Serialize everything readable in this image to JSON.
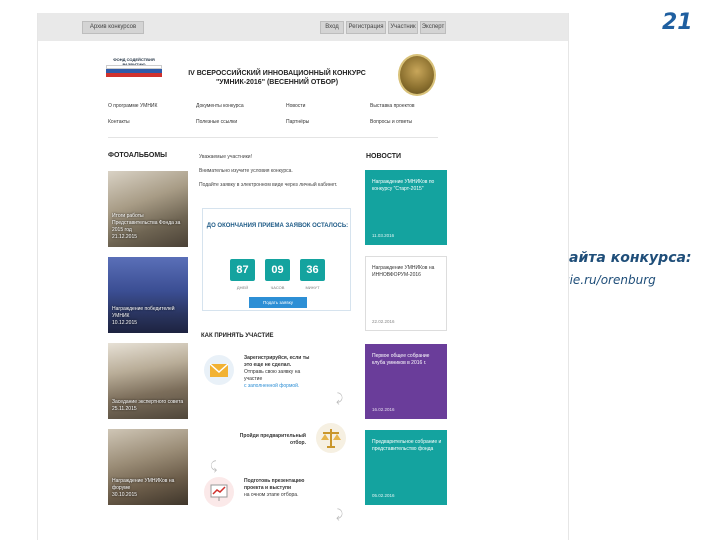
{
  "slide": {
    "page_number": "21",
    "caption_title": "Скриншот сайта конкурса:",
    "caption_url": "http://umnik.fasie.ru/orenburg"
  },
  "site": {
    "topbar": {
      "left_button": "Архив конкурсов",
      "buttons": [
        "Вход",
        "Регистрация",
        "Участник",
        "Эксперт"
      ]
    },
    "header": {
      "title_line1": "IV ВСЕРОССИЙСКИЙ ИННОВАЦИОННЫЙ КОНКУРС",
      "title_line2": "\"УМНИК-2016\" (ВЕСЕННИЙ ОТБОР)",
      "logo_text": "ФОНД СОДЕЙСТВИЯ РАЗВИТИЮ"
    },
    "nav": [
      "О программе УМНИК",
      "Документы конкурса",
      "Новости",
      "Выставка проектов",
      "Контакты",
      "Полезные ссылки",
      "Партнёры",
      "Вопросы и ответы"
    ],
    "photo_albums": {
      "title": "ФОТОАЛЬБОМЫ",
      "items": [
        {
          "caption": "Итоги работы Представительства Фонда за 2015 год",
          "date": "21.12.2015"
        },
        {
          "caption": "Награждение победителей УМНИК",
          "date": "10.12.2015"
        },
        {
          "caption": "Заседание экспертного совета",
          "date": "25.11.2015"
        },
        {
          "caption": "Награждение УМНИКов на форуме",
          "date": "30.10.2015"
        }
      ]
    },
    "middle": {
      "intro1": "Уважаемые участники!",
      "intro2": "Внимательно изучите условия конкурса.",
      "intro3": "Подайте заявку в электронном виде через личный кабинет.",
      "countdown_title": "ДО ОКОНЧАНИЯ ПРИЕМА ЗАЯВОК ОСТАЛОСЬ:",
      "days": "87",
      "hours": "09",
      "minutes": "36",
      "days_label": "ДНЕЙ",
      "hours_label": "ЧАСОВ",
      "minutes_label": "МИНУТ",
      "submit_button": "Подать заявку",
      "how_title": "КАК ПРИНЯТЬ УЧАСТИЕ",
      "step1_line1": "Зарегистрируйся, если ты",
      "step1_line2": "это еще не сделал.",
      "step1_line3": "Отправь свою заявку на",
      "step1_line4": "участие",
      "step1_link": "с заполненной формой.",
      "step2_line1": "Пройди предварительный",
      "step2_line2": "отбор.",
      "step3_line1": "Подготовь презентацию",
      "step3_line2": "проекта и выступи",
      "step3_line3": "на очном этапе отбора."
    },
    "news": {
      "title": "НОВОСТИ",
      "items": [
        {
          "text": "Награждение УМНИКов по конкурсу \"Старт-2015\"",
          "date": "11.03.2016"
        },
        {
          "text": "Награждение УМНИКов на ИННОВФОРУМ-2016",
          "date": "22.02.2016"
        },
        {
          "text": "Первое общее собрание клуба умников в 2016 г.",
          "date": "16.02.2016"
        },
        {
          "text": "Предварительное собрание и представительство фонда",
          "date": "05.02.2016"
        }
      ]
    }
  },
  "colors": {
    "teal": "#14a39f",
    "purple": "#6a3d9a",
    "blue_button": "#2d8fd5",
    "heading_blue": "#1d5a86"
  }
}
